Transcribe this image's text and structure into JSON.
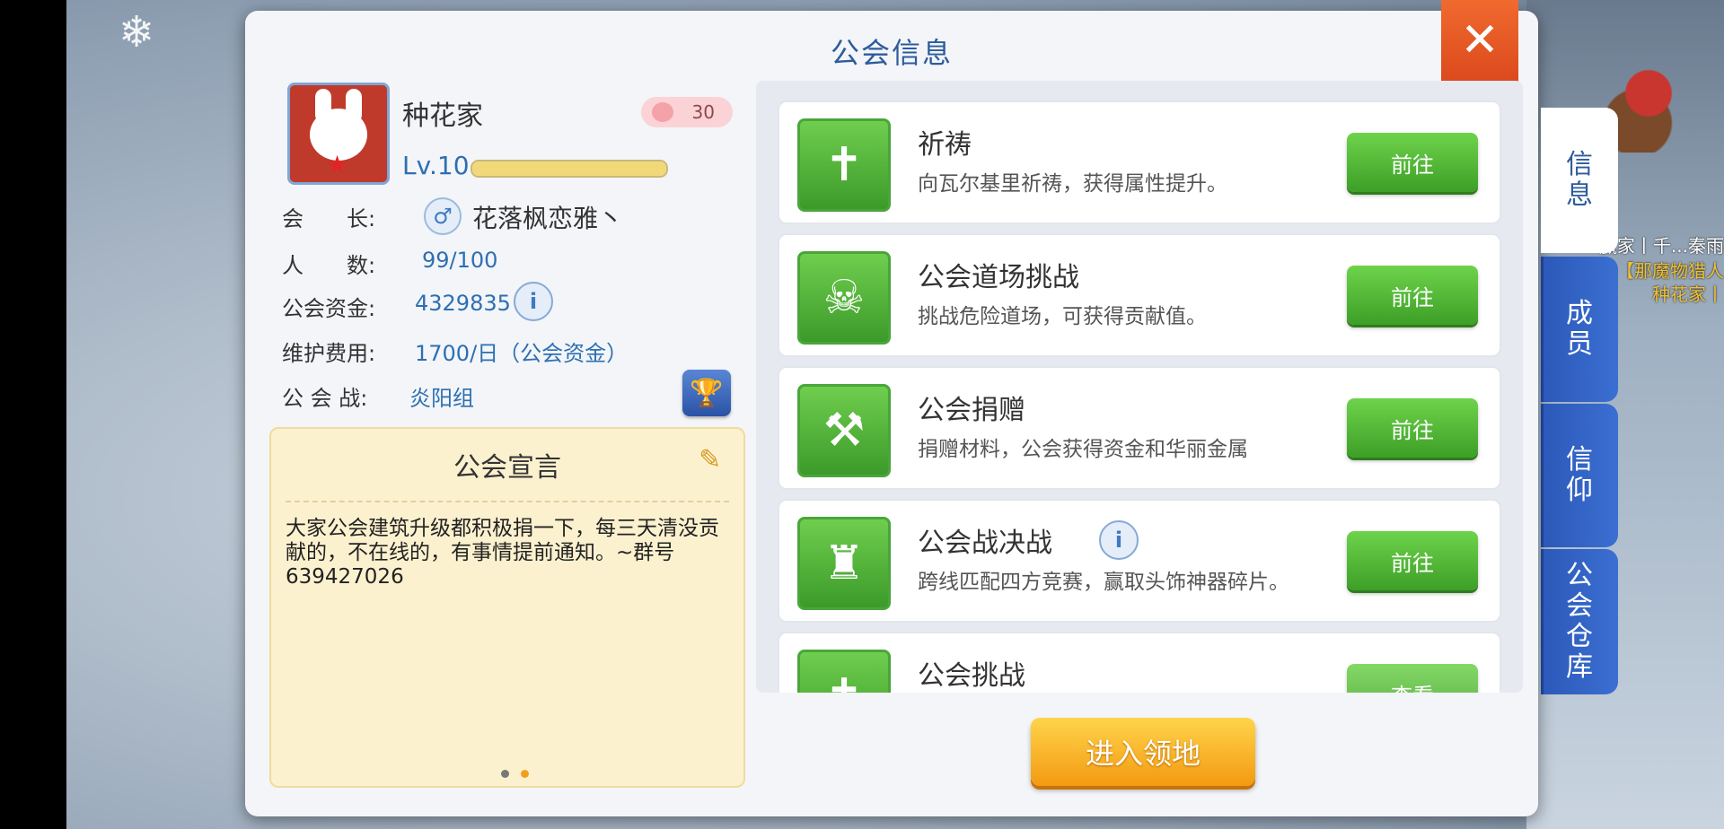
{
  "panel": {
    "title": "公会信息"
  },
  "guild": {
    "name": "种花家",
    "rank": "30",
    "level": "Lv.10",
    "level_progress": 1.0,
    "leader_label": "会　　长:",
    "leader": "花落枫恋雅丶",
    "leader_gender_icon": "♂",
    "members_label": "人　　数:",
    "members": "99/100",
    "funds_label": "公会资金:",
    "funds": "4329835",
    "upkeep_label": "维护费用:",
    "upkeep": "1700/日（公会资金）",
    "war_label": "公 会 战:",
    "war_group": "炎阳组"
  },
  "manifesto": {
    "title": "公会宣言",
    "text": "大家公会建筑升级都积极捐一下，每三天清没贡献的，不在线的，有事情提前通知。~群号639427026",
    "page_dots": [
      "#777777",
      "#f0a020"
    ]
  },
  "activities": [
    {
      "title": "祈祷",
      "desc": "向瓦尔基里祈祷，获得属性提升。",
      "button": "前往",
      "icon": "prayer-icon"
    },
    {
      "title": "公会道场挑战",
      "desc": "挑战危险道场，可获得贡献值。",
      "button": "前往",
      "icon": "skull-icon"
    },
    {
      "title": "公会捐赠",
      "desc": "捐赠材料，公会获得资金和华丽金属",
      "button": "前往",
      "icon": "donate-icon"
    },
    {
      "title": "公会战决战",
      "desc": "跨线匹配四方竞赛，赢取头饰神器碎片。",
      "button": "前往",
      "icon": "castle-icon"
    },
    {
      "title": "公会挑战",
      "desc": "",
      "button": "查看",
      "icon": "challenge-icon"
    }
  ],
  "enter_button": "进入领地",
  "tabs": [
    {
      "label": "信息",
      "active": true
    },
    {
      "label": "成员",
      "active": false
    },
    {
      "label": "信仰",
      "active": false
    },
    {
      "label": "公会仓库",
      "active": false
    }
  ],
  "background": {
    "side_names": [
      "赢家丨千...秦雨",
      "【那魔物猎人",
      "种花家丨"
    ]
  },
  "colors": {
    "accent_blue": "#2d5b9c",
    "go_green": "#4bb62e",
    "enter_orange": "#f5a81c",
    "close_red": "#e4542a"
  }
}
